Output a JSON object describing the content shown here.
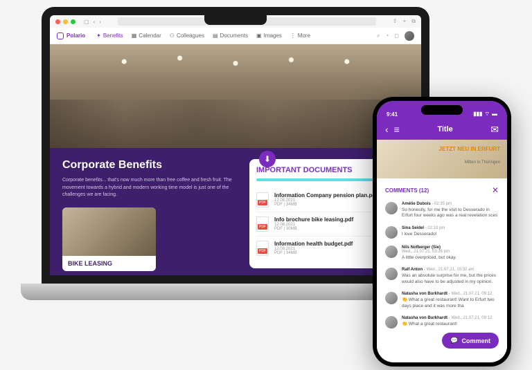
{
  "browser": {
    "time_or_status": ""
  },
  "app": {
    "brand": "Polario",
    "nav": [
      {
        "label": "Benefits",
        "active": true
      },
      {
        "label": "Calendar",
        "active": false
      },
      {
        "label": "Colleagues",
        "active": false
      },
      {
        "label": "Documents",
        "active": false
      },
      {
        "label": "Images",
        "active": false
      },
      {
        "label": "More",
        "active": false
      }
    ]
  },
  "hero": {
    "title": "Corporate Benefits",
    "body": "Corporate benefits... that's now much more than free coffee and fresh fruit. The movement towards a hybrid and modern working time model is just one of the challenges we are facing."
  },
  "bike_card": {
    "title": "BIKE LEASING"
  },
  "docs": {
    "heading": "IMPORTANT DOCUMENTS",
    "items": [
      {
        "name": "Information Company pension plan.pdf",
        "date": "12.08.2021",
        "meta": "PDF | 34MB"
      },
      {
        "name": "Info brochure bike leasing.pdf",
        "date": "12.08.2021",
        "meta": "PDF | 30MB"
      },
      {
        "name": "Information health budget.pdf",
        "date": "12.08.2021",
        "meta": "PDF | 34MB"
      }
    ]
  },
  "phone": {
    "clock": "9:41",
    "header_title": "Title",
    "preview_headline": "JETZT NEU IN ERFURT",
    "preview_sub": "Mitten in Thüringen",
    "comments_heading": "COMMENTS (12)",
    "comment_button": "Comment",
    "comments": [
      {
        "name": "Amélie Dubois",
        "time": "02:35 pm",
        "text": "So honestly, for me the visit to Desserado in Erfurt four weeks ago was a real revelation sces"
      },
      {
        "name": "Sina Seidel",
        "time": "02:10 pm",
        "text": "I love Desserado!"
      },
      {
        "name": "Nils Nofberger (Sie)",
        "time": "Wed., 21.07.21, 03:36 pm",
        "text": "A little overpriced, but okay."
      },
      {
        "name": "Ralf Anton",
        "time": "Wed., 21.07.21, 10:32 am",
        "text": "Was an absolute surprise for me, but the prices would also have to be adjusted in my opinion."
      },
      {
        "name": "Natasha von Burkhardt",
        "time": "Wed., 21.07.21, 09:12",
        "text": "👏 What a great restaurant! Want to Erfurt two days place and it was more tha"
      },
      {
        "name": "Natasha von Burkhardt",
        "time": "Wed., 21.07.21, 09:12",
        "text": "👏 What a great restaurant!"
      }
    ]
  }
}
